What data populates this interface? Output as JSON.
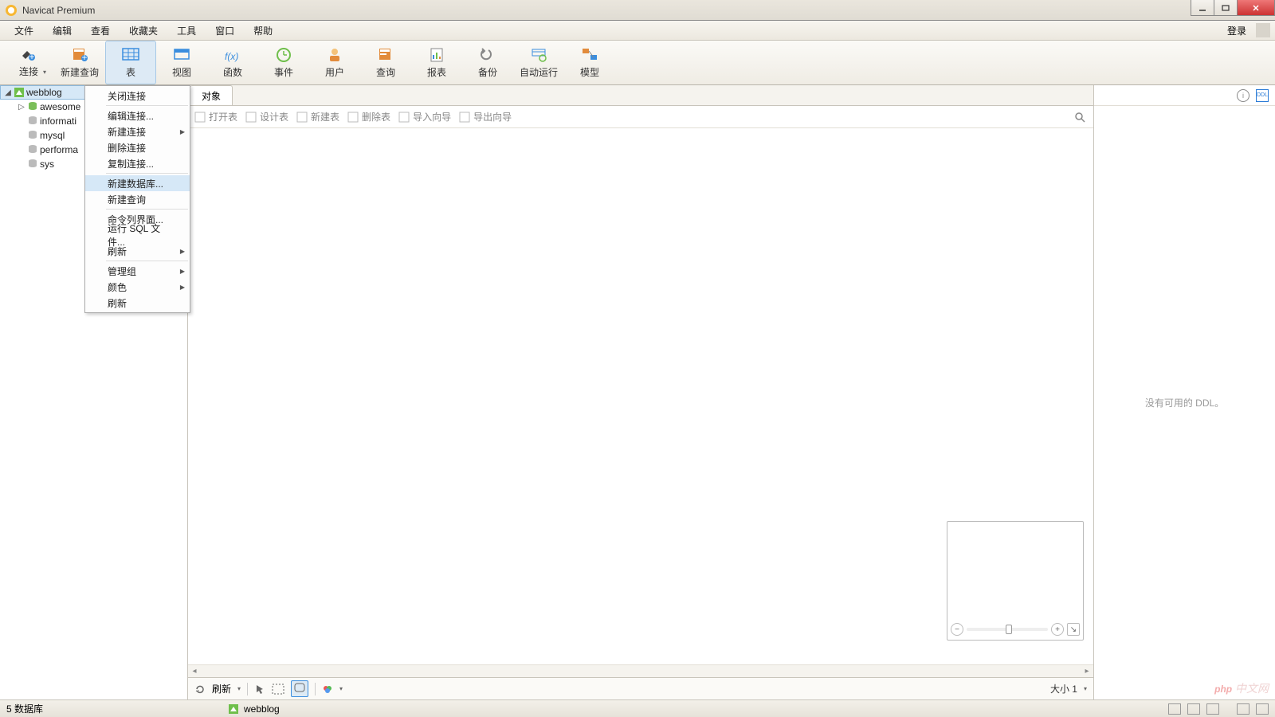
{
  "window": {
    "title": "Navicat Premium"
  },
  "menubar": {
    "items": [
      "文件",
      "编辑",
      "查看",
      "收藏夹",
      "工具",
      "窗口",
      "帮助"
    ],
    "login": "登录"
  },
  "toolbar": {
    "items": [
      {
        "label": "连接",
        "icon": "plug"
      },
      {
        "label": "新建查询",
        "icon": "new-query"
      },
      {
        "label": "表",
        "icon": "table",
        "active": true
      },
      {
        "label": "视图",
        "icon": "view"
      },
      {
        "label": "函数",
        "icon": "fx"
      },
      {
        "label": "事件",
        "icon": "clock"
      },
      {
        "label": "用户",
        "icon": "user"
      },
      {
        "label": "查询",
        "icon": "query"
      },
      {
        "label": "报表",
        "icon": "report"
      },
      {
        "label": "备份",
        "icon": "backup"
      },
      {
        "label": "自动运行",
        "icon": "schedule"
      },
      {
        "label": "模型",
        "icon": "model"
      }
    ]
  },
  "tree": {
    "connection": "webblog",
    "databases": [
      "awesome",
      "informati",
      "mysql",
      "performa",
      "sys"
    ]
  },
  "context_menu": {
    "items": [
      {
        "label": "关闭连接"
      },
      {
        "sep": true
      },
      {
        "label": "编辑连接..."
      },
      {
        "label": "新建连接",
        "sub": true
      },
      {
        "label": "删除连接"
      },
      {
        "label": "复制连接..."
      },
      {
        "sep": true
      },
      {
        "label": "新建数据库...",
        "hover": true
      },
      {
        "label": "新建查询"
      },
      {
        "sep": true
      },
      {
        "label": "命令列界面..."
      },
      {
        "label": "运行 SQL 文件..."
      },
      {
        "label": "刷新",
        "sub": true
      },
      {
        "sep": true
      },
      {
        "label": "管理组",
        "sub": true
      },
      {
        "label": "颜色",
        "sub": true
      },
      {
        "label": "刷新"
      }
    ]
  },
  "object_tab": {
    "label": "对象"
  },
  "object_toolbar": {
    "items": [
      "打开表",
      "设计表",
      "新建表",
      "删除表",
      "导入向导",
      "导出向导"
    ]
  },
  "bottom_toolbar": {
    "refresh": "刷新",
    "size": "大小 1"
  },
  "rightpanel": {
    "empty": "没有可用的 DDL。"
  },
  "statusbar": {
    "left": "5 数据库",
    "conn": "webblog"
  },
  "watermark": "php 中文网"
}
